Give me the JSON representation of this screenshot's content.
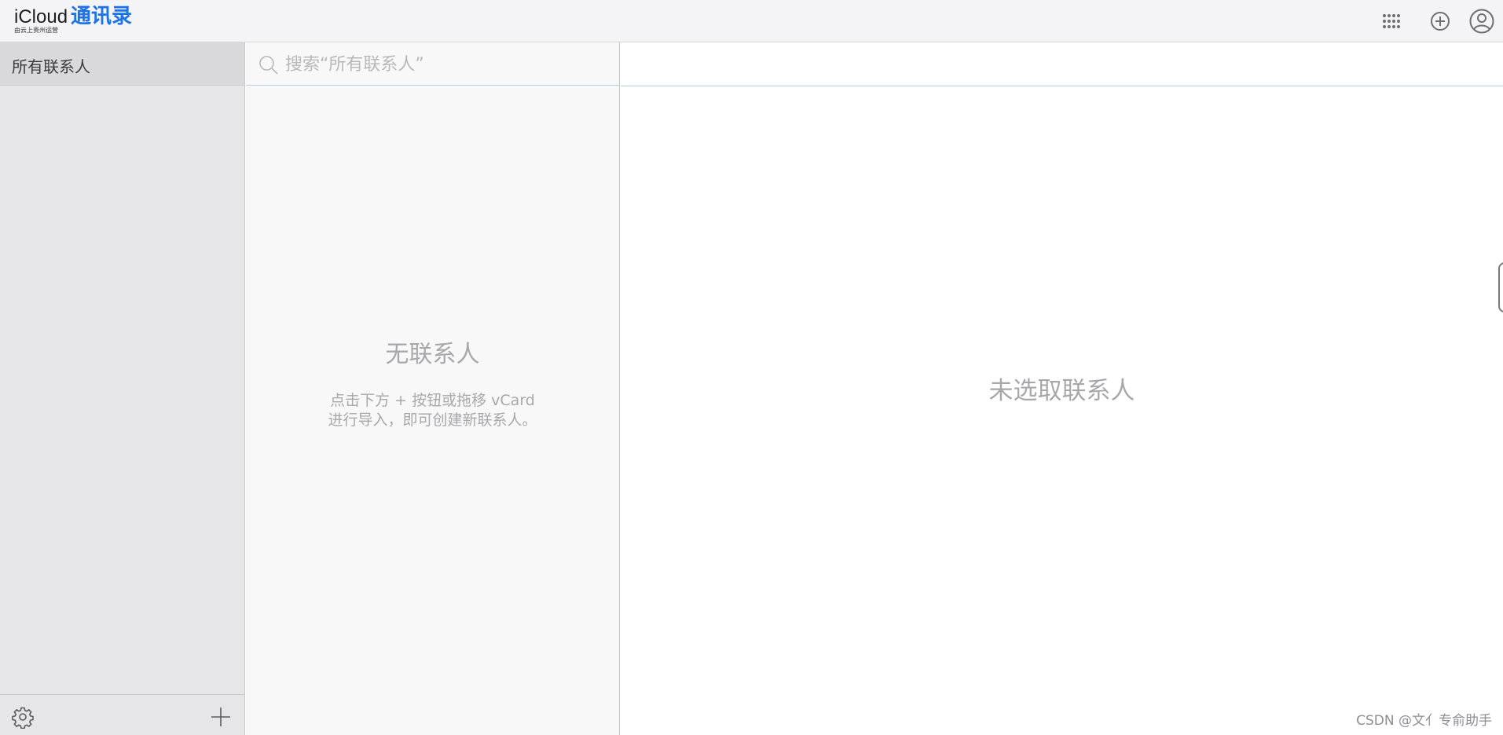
{
  "header": {
    "brand_icloud": "iCloud",
    "brand_app": "通讯录",
    "brand_subtitle": "由云上贵州运营",
    "icons": {
      "apps": "grid-icon",
      "add": "plus-circle-icon",
      "account": "account-circle-icon"
    }
  },
  "sidebar": {
    "groups": [
      {
        "label": "所有联系人"
      }
    ],
    "footer": {
      "settings": "gear-icon",
      "add": "plus-icon"
    }
  },
  "list": {
    "search": {
      "placeholder": "搜索“所有联系人”",
      "value": ""
    },
    "empty": {
      "title": "无联系人",
      "line1": "点击下方 + 按钮或拖移 vCard",
      "line2": "进行导入，即可创建新联系人。"
    }
  },
  "detail": {
    "empty": "未选取联系人"
  },
  "watermark": "CSDN @文亻专俞助手",
  "colors": {
    "accent": "#1a73e8",
    "sidebar_bg": "#e6e6e8",
    "muted_text": "#a8a8ab"
  }
}
